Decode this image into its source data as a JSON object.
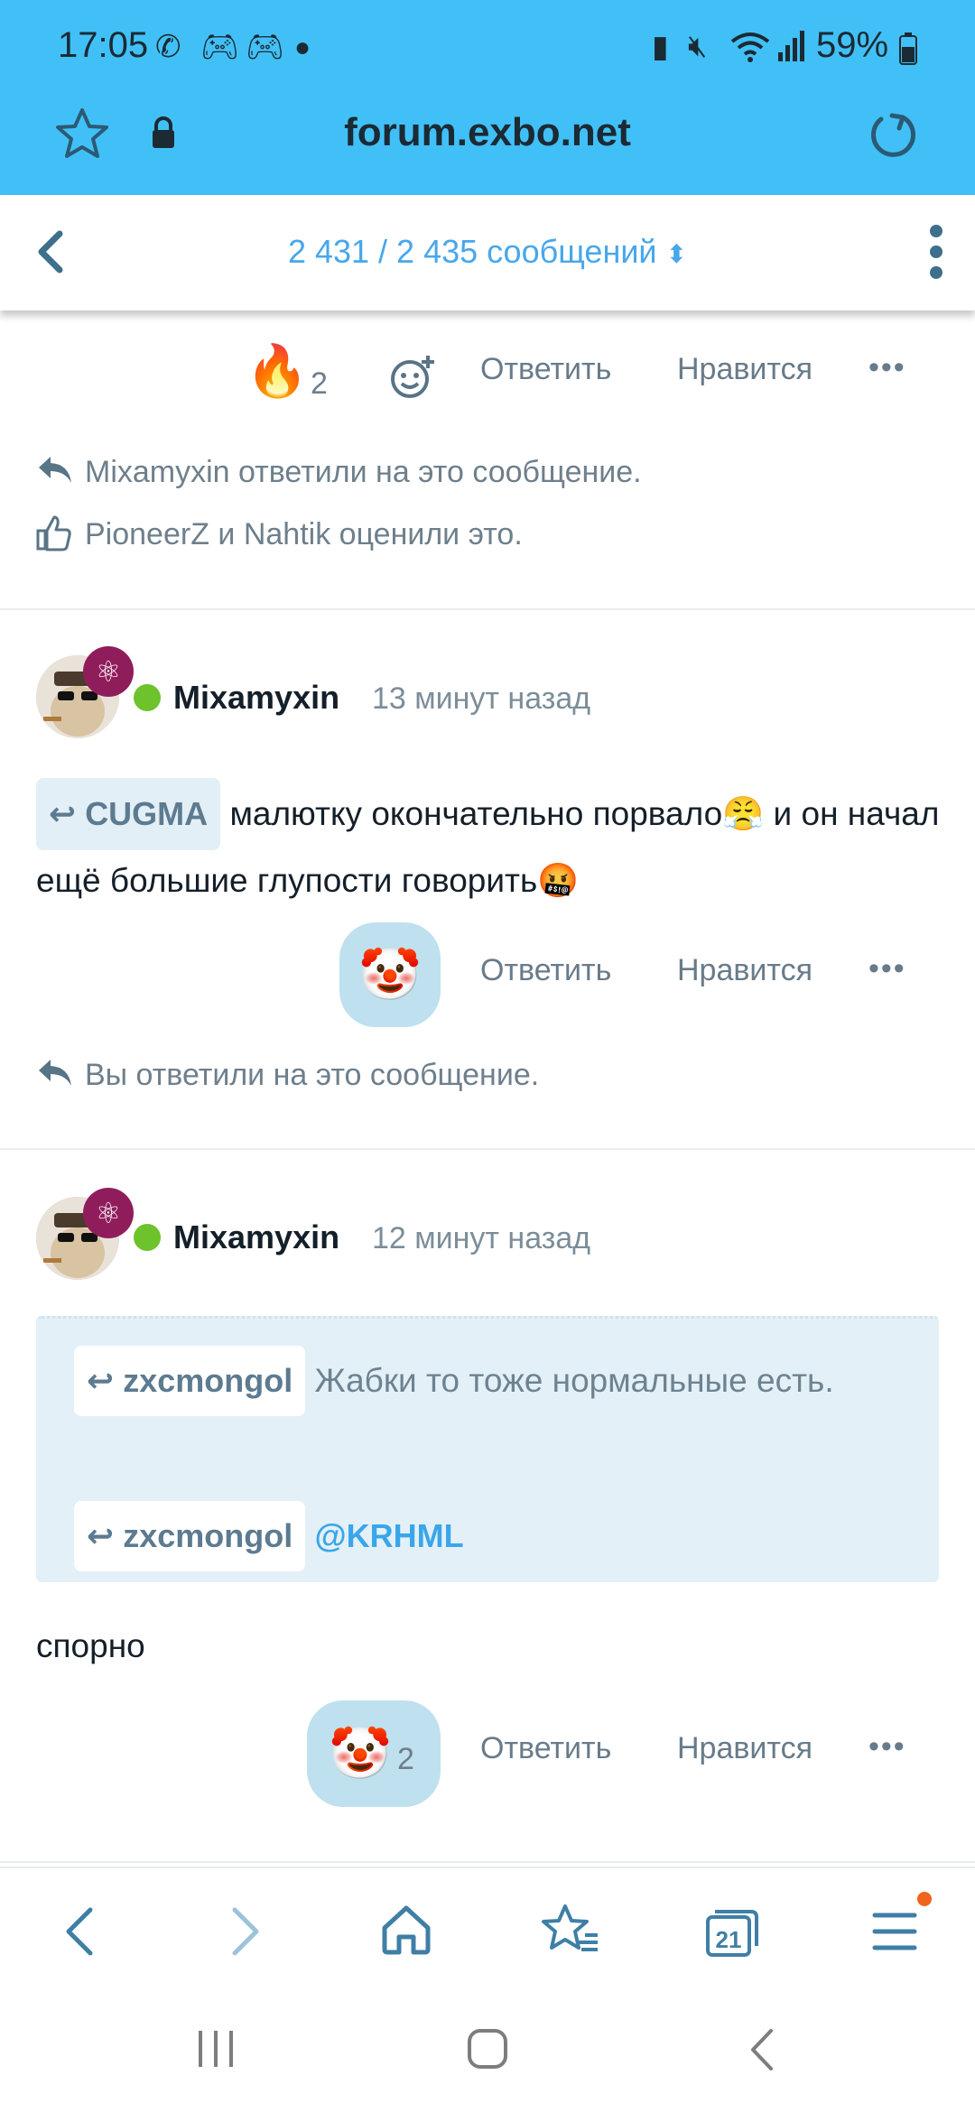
{
  "status_bar": {
    "time": "17:05",
    "battery": "59%",
    "left_icons": [
      "whatsapp-icon",
      "gamepad-icon",
      "gamepad-icon",
      "dot-icon"
    ],
    "right_icons": [
      "battery-saver-icon",
      "mute-icon",
      "wifi-icon",
      "signal-icon",
      "battery-icon"
    ]
  },
  "browser": {
    "url": "forum.exbo.net"
  },
  "thread": {
    "counter": "2 431 / 2 435 сообщений"
  },
  "actions": {
    "reply": "Ответить",
    "like": "Нравится",
    "more": "•••"
  },
  "post0": {
    "fire_count": "2",
    "replied_notice": "Mixamyxin ответили на это сообщение.",
    "liked_notice": "PioneerZ и Nahtik оценили это."
  },
  "post1": {
    "author": "Mixamyxin",
    "time": "13 минут назад",
    "quote_author": "CUGMA",
    "text_part1": "малютку окончательно порвало",
    "text_part2": " и он начал ещё большие глупости говорить",
    "you_replied": "Вы ответили на это сообщение."
  },
  "post2": {
    "author": "Mixamyxin",
    "time": "12 минут назад",
    "quote1_author": "zxcmongol",
    "quote1_text": "Жабки то тоже нормальные есть.",
    "quote2_author": "zxcmongol",
    "quote2_mention": "@KRHML",
    "text": "спорно",
    "clown_count": "2"
  },
  "browser_bottom": {
    "tabs_count": "21"
  }
}
